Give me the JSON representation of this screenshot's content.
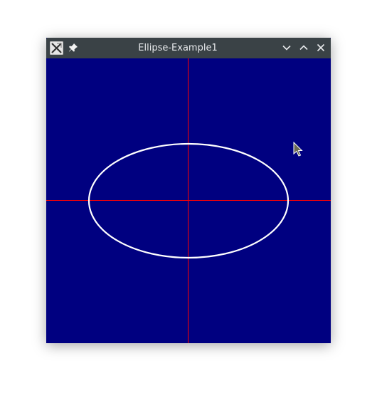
{
  "window": {
    "title": "Ellipse-Example1",
    "icons": {
      "app": "x-app-icon",
      "pin": "pin-icon",
      "minimize": "chevron-down-icon",
      "maximize": "chevron-up-icon",
      "close": "close-icon"
    }
  },
  "canvas": {
    "background_color": "#000080",
    "axis_color": "#ff0000",
    "ellipse_color": "#ffffff"
  },
  "colors": {
    "titlebar": "#3a4246",
    "title_text": "#e8eaec"
  }
}
